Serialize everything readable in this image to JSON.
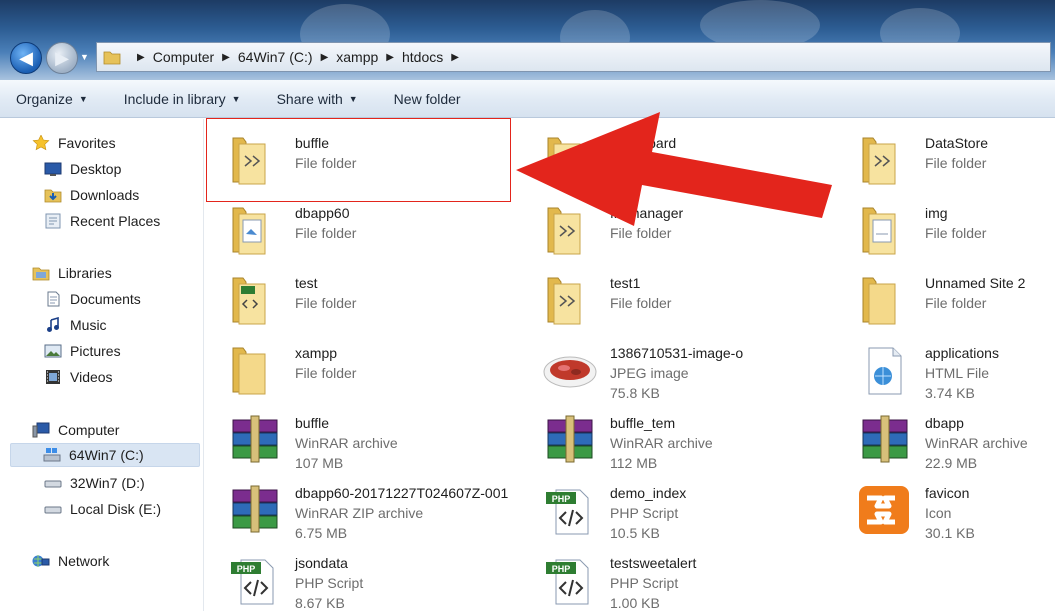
{
  "address": {
    "crumbs": [
      "Computer",
      "64Win7 (C:)",
      "xampp",
      "htdocs"
    ]
  },
  "toolbar": {
    "organize": "Organize",
    "include_in_library": "Include in library",
    "share_with": "Share with",
    "new_folder": "New folder"
  },
  "sidebar": {
    "favorites": "Favorites",
    "desktop": "Desktop",
    "downloads": "Downloads",
    "recent_places": "Recent Places",
    "libraries": "Libraries",
    "documents": "Documents",
    "music": "Music",
    "pictures": "Pictures",
    "videos": "Videos",
    "computer": "Computer",
    "drive_c": "64Win7 (C:)",
    "drive_d": "32Win7 (D:)",
    "drive_e": "Local Disk (E:)",
    "network": "Network"
  },
  "files": [
    {
      "name": "buffle",
      "type": "File folder",
      "size": "",
      "icon": "folder"
    },
    {
      "name": "codeboard",
      "type": "File folder",
      "size": "",
      "icon": "folder"
    },
    {
      "name": "DataStore",
      "type": "File folder",
      "size": "",
      "icon": "folder"
    },
    {
      "name": "dbapp60",
      "type": "File folder",
      "size": "",
      "icon": "folder-doc"
    },
    {
      "name": "filemanager",
      "type": "File folder",
      "size": "",
      "icon": "folder"
    },
    {
      "name": "img",
      "type": "File folder",
      "size": "",
      "icon": "folder-doc"
    },
    {
      "name": "test",
      "type": "File folder",
      "size": "",
      "icon": "folder-php"
    },
    {
      "name": "test1",
      "type": "File folder",
      "size": "",
      "icon": "folder"
    },
    {
      "name": "Unnamed Site 2",
      "type": "File folder",
      "size": "",
      "icon": "folder-empty"
    },
    {
      "name": "xampp",
      "type": "File folder",
      "size": "",
      "icon": "folder-empty"
    },
    {
      "name": "1386710531-image-o",
      "type": "JPEG image",
      "size": "75.8 KB",
      "icon": "jpeg"
    },
    {
      "name": "applications",
      "type": "HTML File",
      "size": "3.74 KB",
      "icon": "html"
    },
    {
      "name": "buffle",
      "type": "WinRAR archive",
      "size": "107 MB",
      "icon": "rar"
    },
    {
      "name": "buffle_tem",
      "type": "WinRAR archive",
      "size": "112 MB",
      "icon": "rar"
    },
    {
      "name": "dbapp",
      "type": "WinRAR archive",
      "size": "22.9 MB",
      "icon": "rar"
    },
    {
      "name": "dbapp60-20171227T024607Z-001",
      "type": "WinRAR ZIP archive",
      "size": "6.75 MB",
      "icon": "rar"
    },
    {
      "name": "demo_index",
      "type": "PHP Script",
      "size": "10.5 KB",
      "icon": "php"
    },
    {
      "name": "favicon",
      "type": "Icon",
      "size": "30.1 KB",
      "icon": "xampp"
    },
    {
      "name": "jsondata",
      "type": "PHP Script",
      "size": "8.67 KB",
      "icon": "php"
    },
    {
      "name": "testsweetalert",
      "type": "PHP Script",
      "size": "1.00 KB",
      "icon": "php"
    }
  ],
  "icon_labels": {
    "php": "PHP"
  },
  "colors": {
    "annotation": "#e3251c",
    "selection": "#d9e5f3"
  }
}
